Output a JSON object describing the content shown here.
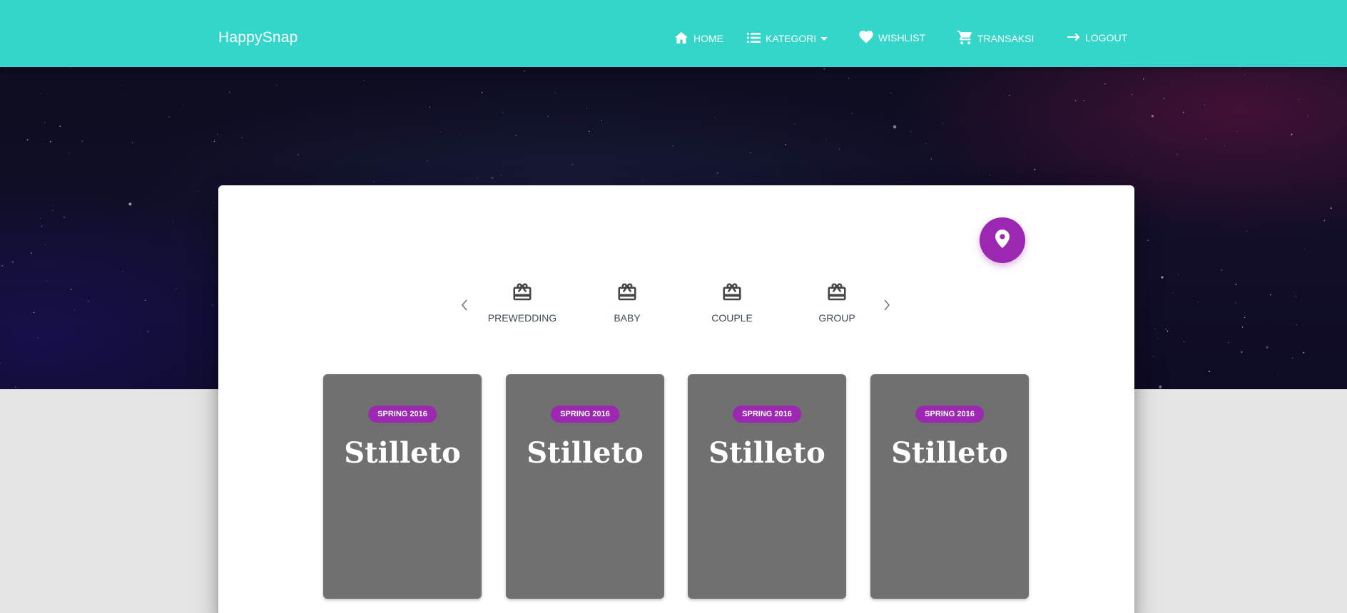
{
  "navbar": {
    "brand": "HappySnap",
    "items": [
      {
        "label": "HOME",
        "icon": "home-icon"
      },
      {
        "label": "KATEGORI",
        "icon": "list-icon",
        "dropdown": true
      },
      {
        "label": "WISHLIST",
        "icon": "heart-icon"
      },
      {
        "label": "TRANSAKSI",
        "icon": "cart-icon"
      },
      {
        "label": "LOGOUT",
        "icon": "arrow-right-icon"
      }
    ]
  },
  "location_button": {
    "icon": "location-pin-icon"
  },
  "categories": [
    {
      "label": "PREWEDDING",
      "icon": "gift-card-icon"
    },
    {
      "label": "BABY",
      "icon": "gift-card-icon"
    },
    {
      "label": "COUPLE",
      "icon": "gift-card-icon"
    },
    {
      "label": "GROUP",
      "icon": "gift-card-icon"
    }
  ],
  "products": [
    {
      "badge": "SPRING 2016",
      "title": "Stilleto"
    },
    {
      "badge": "SPRING 2016",
      "title": "Stilleto"
    },
    {
      "badge": "SPRING 2016",
      "title": "Stilleto"
    },
    {
      "badge": "SPRING 2016",
      "title": "Stilleto"
    }
  ],
  "colors": {
    "navbar": "#33d6c9",
    "accent": "#9c27b0",
    "card_background": "#707070",
    "page_background": "#e5e5e5"
  }
}
